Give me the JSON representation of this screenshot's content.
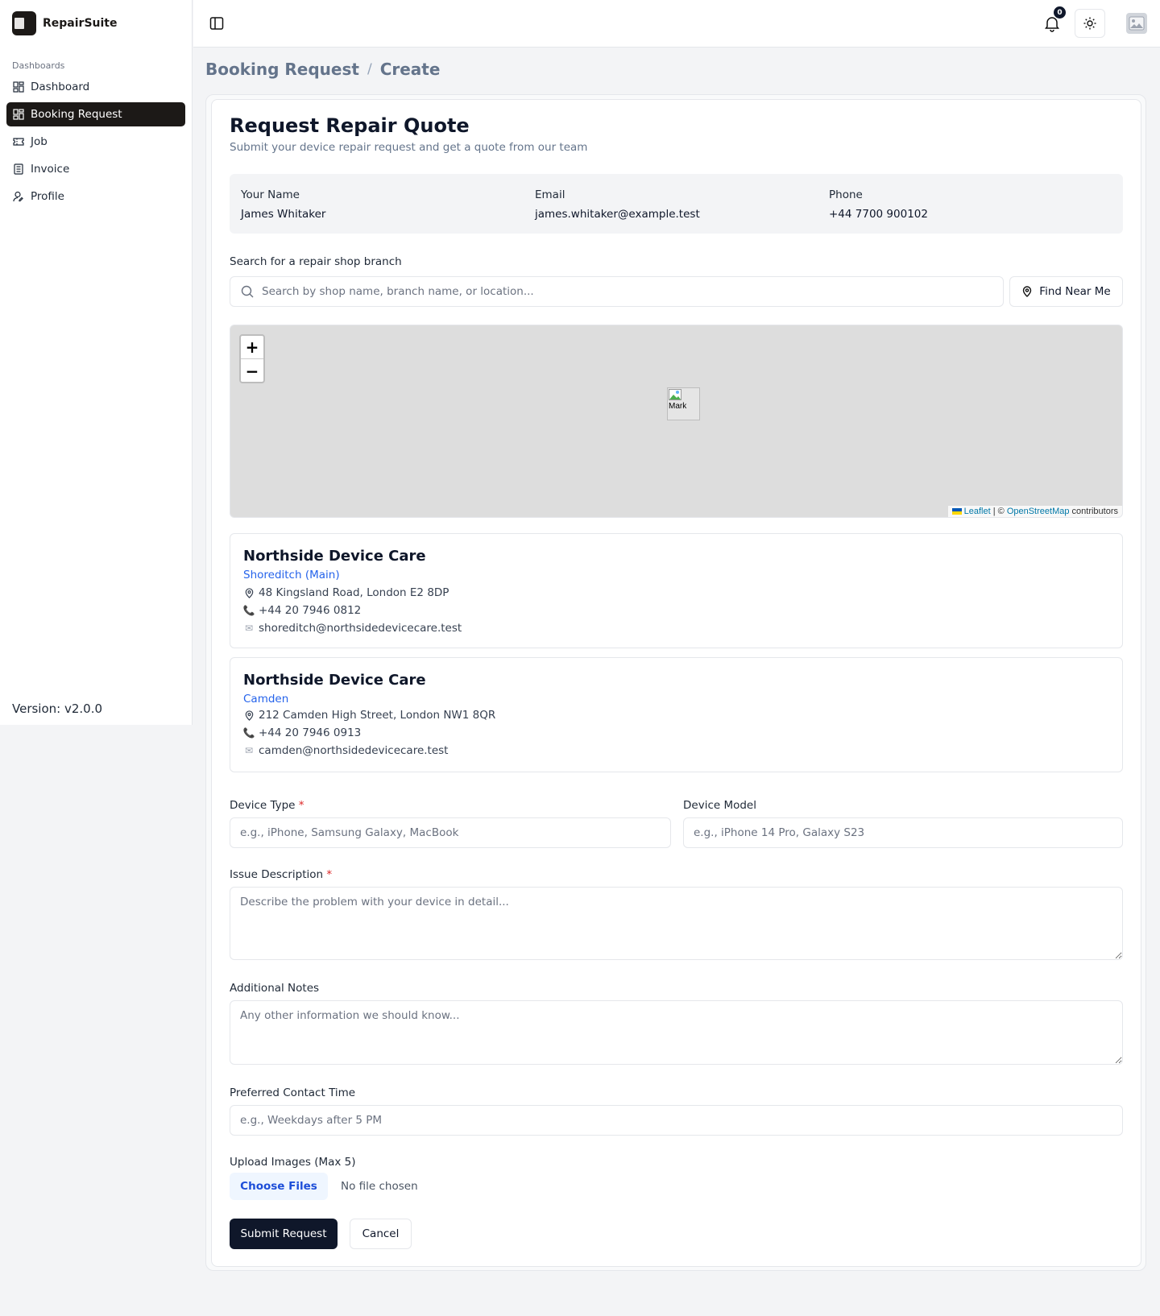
{
  "app": {
    "name": "RepairSuite",
    "version": "Version: v2.0.0"
  },
  "sidebar": {
    "section": "Dashboards",
    "items": [
      {
        "label": "Dashboard",
        "icon": "grid-icon"
      },
      {
        "label": "Booking Request",
        "icon": "grid-icon",
        "active": true
      },
      {
        "label": "Job",
        "icon": "ticket-icon"
      },
      {
        "label": "Invoice",
        "icon": "receipt-icon"
      },
      {
        "label": "Profile",
        "icon": "user-icon"
      }
    ]
  },
  "header": {
    "notification_count": "0"
  },
  "breadcrumb": {
    "parent": "Booking Request",
    "separator": "/",
    "current": "Create"
  },
  "form": {
    "title": "Request Repair Quote",
    "subtitle": "Submit your device repair request and get a quote from our team",
    "customer": {
      "name_label": "Your Name",
      "name_value": "James Whitaker",
      "email_label": "Email",
      "email_value": "james.whitaker@example.test",
      "phone_label": "Phone",
      "phone_value": "+44 7700 900102"
    },
    "search": {
      "label": "Search for a repair shop branch",
      "placeholder": "Search by shop name, branch name, or location...",
      "find_button": "Find Near Me"
    },
    "map": {
      "zoom_in": "+",
      "zoom_out": "−",
      "marker_alt": "Mark",
      "attribution_leaflet": "Leaflet",
      "attribution_sep": " | © ",
      "attribution_osm": "OpenStreetMap",
      "attribution_suffix": " contributors"
    },
    "branches": [
      {
        "name": "Northside Device Care",
        "branch": "Shoreditch (Main)",
        "address": "48 Kingsland Road, London E2 8DP",
        "phone": "+44 20 7946 0812",
        "email": "shoreditch@northsidedevicecare.test"
      },
      {
        "name": "Northside Device Care",
        "branch": "Camden",
        "address": "212 Camden High Street, London NW1 8QR",
        "phone": "+44 20 7946 0913",
        "email": "camden@northsidedevicecare.test"
      }
    ],
    "device_type": {
      "label": "Device Type",
      "required": "*",
      "placeholder": "e.g., iPhone, Samsung Galaxy, MacBook"
    },
    "device_model": {
      "label": "Device Model",
      "placeholder": "e.g., iPhone 14 Pro, Galaxy S23"
    },
    "issue": {
      "label": "Issue Description",
      "required": "*",
      "placeholder": "Describe the problem with your device in detail..."
    },
    "notes": {
      "label": "Additional Notes",
      "placeholder": "Any other information we should know..."
    },
    "contact_time": {
      "label": "Preferred Contact Time",
      "placeholder": "e.g., Weekdays after 5 PM"
    },
    "upload": {
      "label": "Upload Images (Max 5)",
      "button": "Choose Files",
      "status": "No file chosen"
    },
    "submit_button": "Submit Request",
    "cancel_button": "Cancel"
  },
  "colors": {
    "primary": "#0f172a",
    "link": "#2563eb",
    "required": "#dc2626",
    "sidebar_active": "#1c1917"
  }
}
